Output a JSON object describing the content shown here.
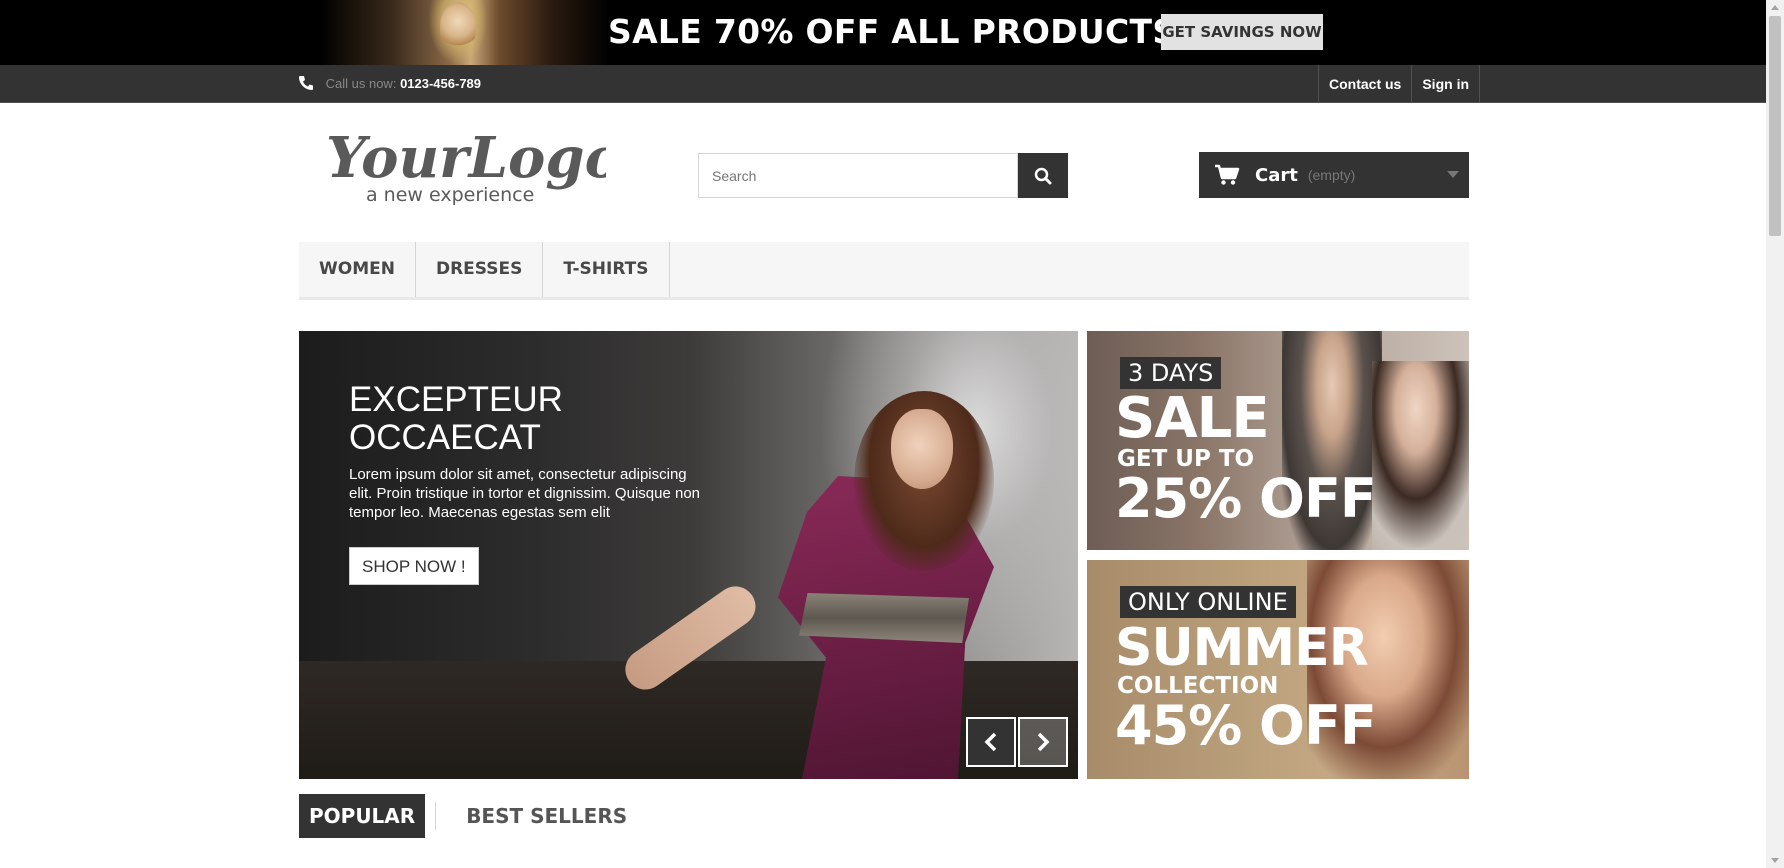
{
  "promo": {
    "title": "SALE 70% OFF ALL PRODUCTS",
    "button_label": "GET SAVINGS NOW"
  },
  "topbar": {
    "call_label": "Call us now:",
    "phone": "0123-456-789",
    "links": [
      "Contact us",
      "Sign in"
    ]
  },
  "header": {
    "logo_text": "YourLogo",
    "logo_tagline": "a new experience",
    "search_placeholder": "Search",
    "cart_label": "Cart",
    "cart_state": "(empty)"
  },
  "menu": {
    "items": [
      "WOMEN",
      "DRESSES",
      "T-SHIRTS"
    ]
  },
  "slider": {
    "title_line1": "EXCEPTEUR",
    "title_line2": "OCCAECAT",
    "description": "Lorem ipsum dolor sit amet, consectetur adipiscing elit. Proin tristique in tortor et dignissim. Quisque non tempor leo. Maecenas egestas sem elit",
    "button_label": "SHOP NOW !"
  },
  "banners": [
    {
      "tag": "3 DAYS",
      "big": "SALE",
      "mid": "GET UP TO",
      "off": "25% OFF"
    },
    {
      "tag": "ONLY ONLINE",
      "big": "SUMMER",
      "mid": "COLLECTION",
      "off": "45% OFF"
    }
  ],
  "tabs": {
    "active": "POPULAR",
    "inactive": "BEST SELLERS"
  },
  "colors": {
    "dark": "#333333",
    "promo_bg": "#000000",
    "menu_bg": "#f6f6f6"
  }
}
